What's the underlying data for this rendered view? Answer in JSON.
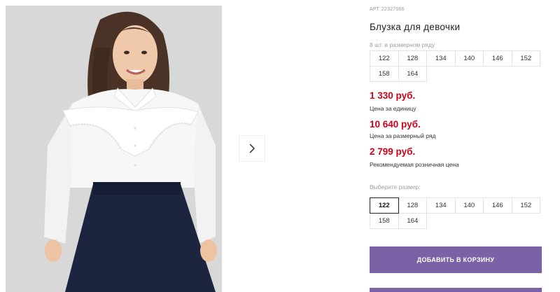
{
  "product": {
    "article_label": "АРТ",
    "article_number": "22327066",
    "title": "Блузка для девочки"
  },
  "size_row": {
    "caption": "8 шт. в размерном ряду",
    "sizes": [
      "122",
      "128",
      "134",
      "140",
      "146",
      "152",
      "158",
      "164"
    ]
  },
  "prices": {
    "unit_price": "1 330 руб.",
    "unit_note": "Цена за единицу",
    "row_price": "10 640 руб.",
    "row_note": "Цена за размерный ряд",
    "retail_price": "2 799 руб.",
    "retail_note": "Рекомендуемая розничная цена"
  },
  "size_select": {
    "caption": "Выберите размер:",
    "sizes": [
      "122",
      "128",
      "134",
      "140",
      "146",
      "152",
      "158",
      "164"
    ],
    "selected": "122"
  },
  "actions": {
    "add_to_cart": "ДОБАВИТЬ В КОРЗИНУ"
  },
  "colors": {
    "price_red": "#d0021b",
    "button_purple": "#7b62a6"
  },
  "icons": {
    "gallery_next": "chevron-right-icon"
  }
}
